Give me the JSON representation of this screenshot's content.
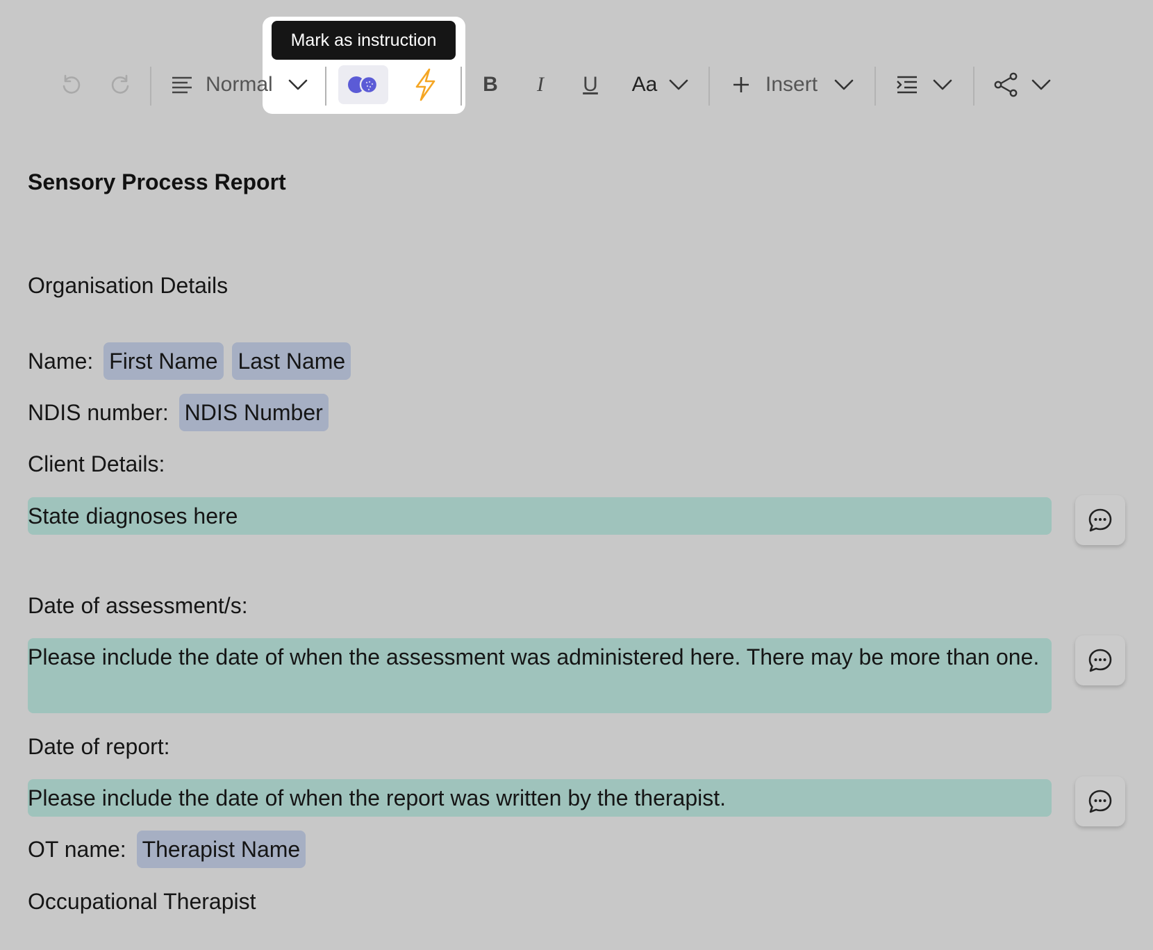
{
  "toolbar": {
    "tooltip": "Mark as instruction",
    "style_label": "Normal",
    "insert_label": "Insert",
    "font_label": "Aa",
    "bold_label": "B",
    "italic_label": "I",
    "underline_label": "U",
    "accent_color": "#5b5bd6",
    "lightning_color": "#f5a623"
  },
  "document": {
    "title": "Sensory Process Report",
    "org_heading": "Organisation Details",
    "name_label": "Name:",
    "first_name_chip": "First Name",
    "last_name_chip": "Last Name",
    "ndis_label": "NDIS number:",
    "ndis_chip": "NDIS Number",
    "client_label": "Client Details:",
    "client_instruction": "State diagnoses here",
    "assess_label": "Date of assessment/s:",
    "assess_instruction": "Please include the date of when the assessment was administered here. There may be more than one.",
    "report_label": "Date of report:",
    "report_instruction": "Please include the date of when the report was written by the therapist.",
    "ot_label": "OT name:",
    "ot_chip": "Therapist Name",
    "ot_role": "Occupational Therapist"
  },
  "colors": {
    "background": "#c8c8c8",
    "instruction_bg": "#9fc3bc",
    "chip_bg": "#a6afc3"
  }
}
